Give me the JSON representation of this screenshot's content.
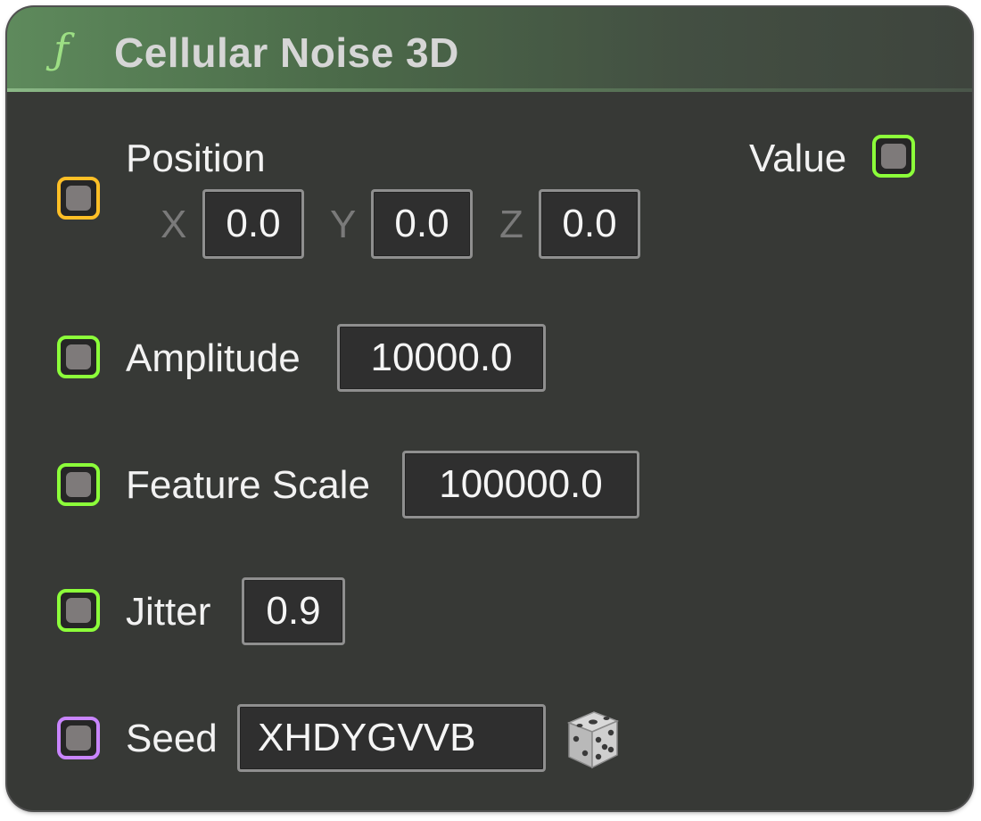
{
  "node": {
    "icon": "function-icon",
    "icon_glyph": "ƒ",
    "title": "Cellular Noise 3D"
  },
  "position": {
    "label": "Position",
    "x_label": "X",
    "x_value": "0.0",
    "y_label": "Y",
    "y_value": "0.0",
    "z_label": "Z",
    "z_value": "0.0",
    "pin_color": "#ffbf26"
  },
  "output": {
    "label": "Value",
    "pin_color": "#8cff3a"
  },
  "amplitude": {
    "label": "Amplitude",
    "value": "10000.0",
    "pin_color": "#8cff3a"
  },
  "feature_scale": {
    "label": "Feature Scale",
    "value": "100000.0",
    "pin_color": "#8cff3a"
  },
  "jitter": {
    "label": "Jitter",
    "value": "0.9",
    "pin_color": "#8cff3a"
  },
  "seed": {
    "label": "Seed",
    "value": "XHDYGVVB",
    "pin_color": "#c985ff",
    "randomize_icon": "dice-icon"
  },
  "colors": {
    "node_bg": "#373936",
    "header_accent": "#5e8a5c",
    "title_text": "#d6d6d6"
  }
}
